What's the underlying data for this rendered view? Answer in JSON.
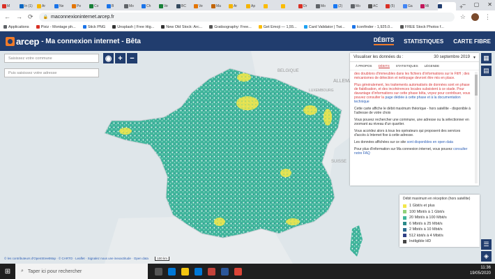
{
  "browser": {
    "tabs": [
      {
        "label": "M",
        "color": "#d93025"
      },
      {
        "label": "In (1)",
        "color": "#0a66c2"
      },
      {
        "label": "Ar",
        "color": "#f4b400"
      },
      {
        "label": "Ne",
        "color": "#1a73e8"
      },
      {
        "label": "Pe",
        "color": "#e37400"
      },
      {
        "label": "Co",
        "color": "#188038"
      },
      {
        "label": "B",
        "color": "#1a73e8"
      },
      {
        "label": "Mo",
        "color": "#5f6368"
      },
      {
        "label": "Ch",
        "color": "#1a73e8"
      },
      {
        "label": "Ve",
        "color": "#188038"
      },
      {
        "label": "BC",
        "color": "#34495e"
      },
      {
        "label": "Ve",
        "color": "#e37400"
      },
      {
        "label": "Ma",
        "color": "#c26401"
      },
      {
        "label": "Ar",
        "color": "#f4b400"
      },
      {
        "label": "Ap",
        "color": "#f4b400"
      },
      {
        "label": "",
        "color": "#fbbc04"
      },
      {
        "label": "",
        "color": "#fbbc04"
      },
      {
        "label": "Dr",
        "color": "#d93025"
      },
      {
        "label": "Mo",
        "color": "#5f6368"
      },
      {
        "label": "(2)",
        "color": "#1877f2"
      },
      {
        "label": "Mo",
        "color": "#5f6368"
      },
      {
        "label": "AC",
        "color": "#555"
      },
      {
        "label": "(5)",
        "color": "#d93025"
      },
      {
        "label": "Ga",
        "color": "#4285f4"
      },
      {
        "label": "Mi",
        "color": "#c2185b"
      },
      {
        "label": "",
        "color": "#213d6e"
      }
    ],
    "url": "maconnexioninternet.arcep.fr",
    "bookmarks": [
      {
        "label": "Applications",
        "color": "#5f6368"
      },
      {
        "label": "Pixiz - Montage ph...",
        "color": "#d93025"
      },
      {
        "label": "Stick PNG",
        "color": "#1a73e8"
      },
      {
        "label": "Unsplash | Free Hig...",
        "color": "#333"
      },
      {
        "label": "New Old Stock: Arc...",
        "color": "#333"
      },
      {
        "label": "Gratisography: Free...",
        "color": "#555"
      },
      {
        "label": "Get Emoji — 1,55...",
        "color": "#fbbc04"
      },
      {
        "label": "Card Validator | Twi...",
        "color": "#1da1f2"
      },
      {
        "label": "Iconfinder - 1,925.0...",
        "color": "#1a73e8"
      },
      {
        "label": "FREE Stock Photos f...",
        "color": "#555"
      }
    ]
  },
  "header": {
    "logo_text": "arcep",
    "site_title": "- Ma connexion internet - Bêta",
    "nav": [
      "DÉBITS",
      "STATISTIQUES",
      "CARTE FIBRE"
    ]
  },
  "map": {
    "search_commune_placeholder": "Saisissez votre commune",
    "search_address_placeholder": "Puis saisissez votre adresse",
    "zoom_in": "+",
    "zoom_out": "−",
    "labels": {
      "belgique": "BELGIQUE",
      "luxembourg": "LUXEMBOURG",
      "allemagne": "ALLEMAGNE",
      "suisse": "SUISSE"
    },
    "attribution": "© les contributeurs d'OpenStreetMap · © CARTO · Leaflet · Signalez nous une inexactitude · Open data",
    "scale": "100 km"
  },
  "panel": {
    "visualiser_label": "Visualiser les données du :",
    "date_value": "30 septembre 2019",
    "tabs": [
      "À PROPOS",
      "DÉBITS",
      "STATISTIQUES",
      "LÉGENDE"
    ],
    "para_top_red": "des doublons d'immeubles dans les fichiers d'informations sur le FttH ; des mécanismes de détection et nettoyage devront être mis en place.",
    "para_red2": "Plus généralement, les traitements automatisés de données sont en phase de fiabilisation, et des incohérences locales subsistent à ce stade. Pour davantage d'informations sur cette phase bêta, voyez pour contribuer, vous pouvez consulter la",
    "para_red2_link": "page dédiée à cette phase et à la documentation technique",
    "para3": "Cette carte affiche le débit maximum théorique - hors satellite - disponible à l'adresse de votre choix",
    "para4": "Vous pouvez rechercher une commune, une adresse ou la sélectionner en zoomant au niveau d'un quartier.",
    "para5": "Vous accédez alors à tous les opérateurs qui proposent des services d'accès à Internet fixe à cette adresse.",
    "para6": "Les données affichées sur ce site",
    "para6_link": "sont disponibles en open data",
    "para7": "Pour plus d'information sur Ma connexion internet, vous pouvez",
    "para7_link": "consulter notre FAQ"
  },
  "legend": {
    "title": "Débit maximum en réception (hors satellite)",
    "items": [
      {
        "label": "1 Gbit/s et plus",
        "color": "#f2e74b"
      },
      {
        "label": "100 Mbit/s à 1 Gbit/s",
        "color": "#93d17a"
      },
      {
        "label": "20 Mbit/s à 100 Mbit/s",
        "color": "#3fb59b"
      },
      {
        "label": "6 Mbit/s à 25 Mbit/s",
        "color": "#2a8a8a"
      },
      {
        "label": "2 Mbit/s à 10 Mbit/s",
        "color": "#2d6b8f"
      },
      {
        "label": "512 kbit/s à 4 Mbit/s",
        "color": "#2f3f85"
      },
      {
        "label": "Inéligible HD",
        "color": "#444"
      }
    ]
  },
  "taskbar": {
    "search_placeholder": "Taper ici pour rechercher",
    "time": "11:36",
    "date": "19/05/2020"
  }
}
